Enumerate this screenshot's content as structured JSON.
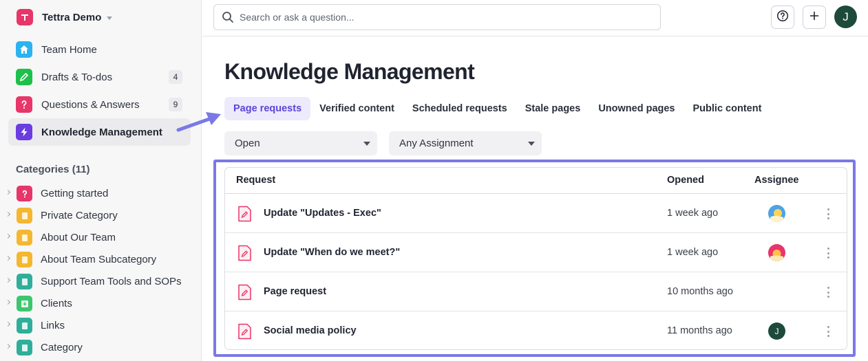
{
  "workspace": {
    "name": "Tettra Demo"
  },
  "nav": [
    {
      "label": "Team Home",
      "icon": "home-icon",
      "color": "#2bb3f0"
    },
    {
      "label": "Drafts & To-dos",
      "icon": "pencil-icon",
      "color": "#1fbf4b",
      "count": "4"
    },
    {
      "label": "Questions & Answers",
      "icon": "question-icon",
      "color": "#e8356a",
      "count": "9"
    },
    {
      "label": "Knowledge Management",
      "icon": "lightning-icon",
      "color": "#6a3de0"
    }
  ],
  "categories_header": "Categories (11)",
  "categories": [
    {
      "label": "Getting started",
      "icon": "question-icon",
      "color": "#e8356a"
    },
    {
      "label": "Private Category",
      "icon": "book-icon",
      "color": "#f5b731"
    },
    {
      "label": "About Our Team",
      "icon": "book-icon",
      "color": "#f5b731"
    },
    {
      "label": "About Team Subcategory",
      "icon": "book-icon",
      "color": "#f5b731"
    },
    {
      "label": "Support Team Tools and SOPs",
      "icon": "book-icon",
      "color": "#2fae9a"
    },
    {
      "label": "Clients",
      "icon": "inbox-icon",
      "color": "#3cc66f"
    },
    {
      "label": "Links",
      "icon": "book-icon",
      "color": "#2fae9a"
    },
    {
      "label": "Category",
      "icon": "book-icon",
      "color": "#2fae9a"
    }
  ],
  "search": {
    "placeholder": "Search or ask a question..."
  },
  "topbar": {
    "avatar_initial": "J"
  },
  "page": {
    "title": "Knowledge Management"
  },
  "tabs": [
    "Page requests",
    "Verified content",
    "Scheduled requests",
    "Stale pages",
    "Unowned pages",
    "Public content"
  ],
  "filters": {
    "status": "Open",
    "assignment": "Any Assignment"
  },
  "table": {
    "headers": {
      "request": "Request",
      "opened": "Opened",
      "assignee": "Assignee"
    },
    "rows": [
      {
        "title": "Update \"Updates - Exec\"",
        "opened": "1 week ago",
        "assignee": "avatar-sun-icon"
      },
      {
        "title": "Update \"When do we meet?\"",
        "opened": "1 week ago",
        "assignee": "avatar-sunset-icon"
      },
      {
        "title": "Page request",
        "opened": "10 months ago",
        "assignee": ""
      },
      {
        "title": "Social media policy",
        "opened": "11 months ago",
        "assignee": "J"
      }
    ]
  },
  "colors": {
    "accent": "#5b45d6",
    "highlight": "#7b78e6"
  }
}
